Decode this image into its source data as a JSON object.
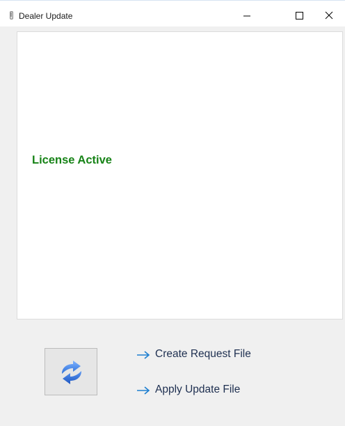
{
  "window": {
    "title": "Dealer Update",
    "app_icon": "dealer-app-icon",
    "controls": {
      "minimize_icon": "minimize-icon",
      "maximize_icon": "maximize-icon",
      "close_icon": "close-icon"
    }
  },
  "main": {
    "license_status": "License Active",
    "license_status_color": "#178317"
  },
  "actions": {
    "refresh_icon": "refresh-icon",
    "create_request_label": "Create Request File",
    "apply_update_label": "Apply Update File",
    "arrow_icon": "arrow-right-icon",
    "link_arrow_color": "#1e7fd0"
  }
}
